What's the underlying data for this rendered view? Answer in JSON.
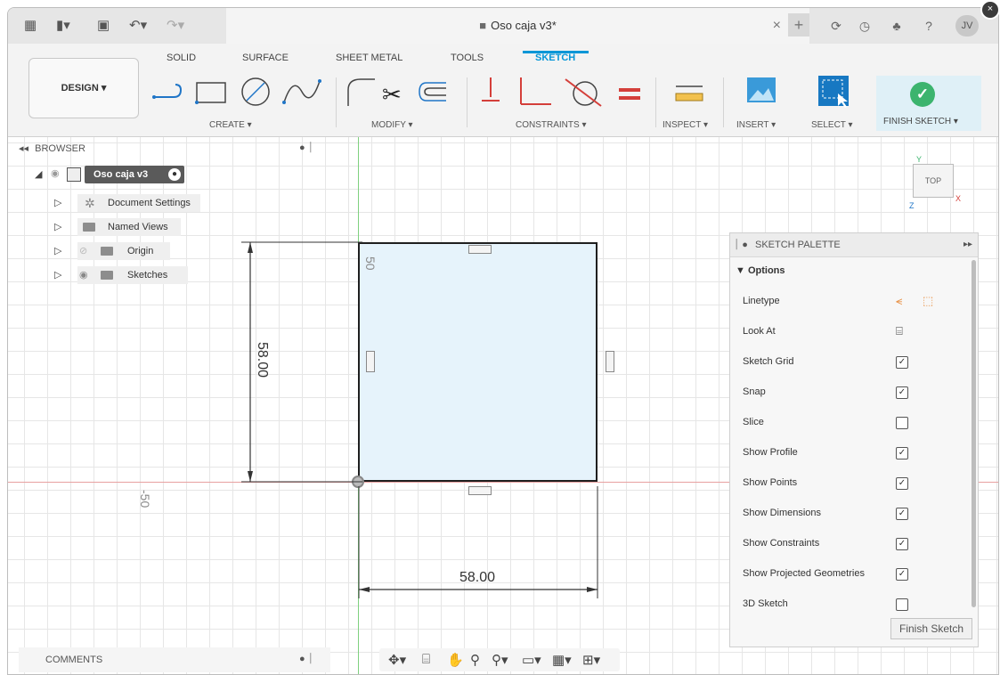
{
  "titlebar": {
    "doc_title": "Oso caja v3*",
    "close_symbol": "×",
    "plus_symbol": "+",
    "avatar_initials": "JV"
  },
  "ribbon": {
    "design_label": "DESIGN ▾",
    "tabs": [
      "SOLID",
      "SURFACE",
      "SHEET METAL",
      "TOOLS",
      "SKETCH"
    ],
    "active_tab": "SKETCH",
    "groups": {
      "create": "CREATE ▾",
      "modify": "MODIFY ▾",
      "constraints": "CONSTRAINTS ▾",
      "inspect": "INSPECT ▾",
      "insert": "INSERT ▾",
      "select": "SELECT ▾",
      "finish": "FINISH SKETCH ▾"
    }
  },
  "browser": {
    "header": "BROWSER",
    "root": "Oso caja v3",
    "items": [
      {
        "label": "Document Settings"
      },
      {
        "label": "Named Views"
      },
      {
        "label": "Origin"
      },
      {
        "label": "Sketches"
      }
    ]
  },
  "canvas": {
    "dim_vertical": "58.00",
    "dim_horizontal": "58.00",
    "label_50_top": "50",
    "label_neg50": "-50",
    "viewcube_label": "TOP",
    "axis_y": "Y",
    "axis_x": "X",
    "axis_z": "Z"
  },
  "palette": {
    "title": "SKETCH PALETTE",
    "section": "▼ Options",
    "rows": [
      {
        "label": "Linetype",
        "kind": "icons"
      },
      {
        "label": "Look At",
        "kind": "icon"
      },
      {
        "label": "Sketch Grid",
        "checked": true
      },
      {
        "label": "Snap",
        "checked": true
      },
      {
        "label": "Slice",
        "checked": false
      },
      {
        "label": "Show Profile",
        "checked": true
      },
      {
        "label": "Show Points",
        "checked": true
      },
      {
        "label": "Show Dimensions",
        "checked": true
      },
      {
        "label": "Show Constraints",
        "checked": true
      },
      {
        "label": "Show Projected Geometries",
        "checked": true
      },
      {
        "label": "3D Sketch",
        "checked": false
      }
    ],
    "finish_button": "Finish Sketch"
  },
  "comments": {
    "label": "COMMENTS"
  },
  "colors": {
    "accent": "#0696d7",
    "finish_green": "#3cb46e",
    "sketch_fill": "#e6f3fb"
  }
}
